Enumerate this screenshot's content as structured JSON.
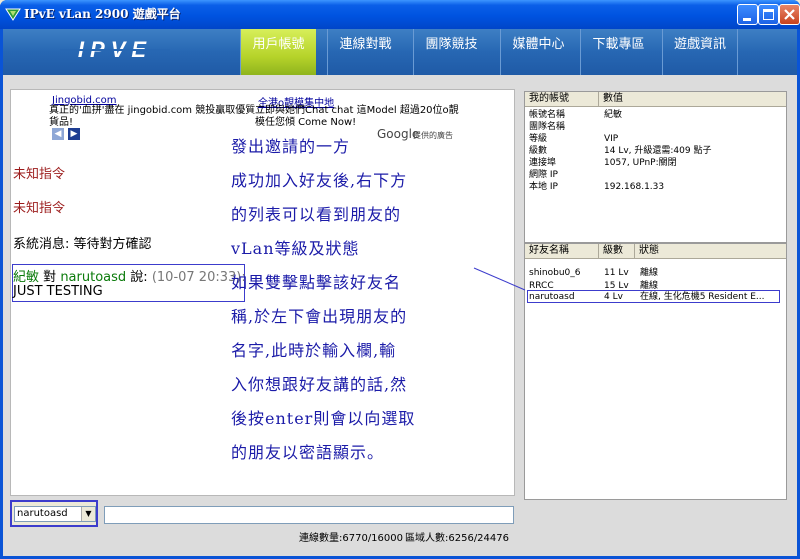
{
  "window": {
    "title": "IPvE vLan 2900 遊戲平台"
  },
  "nav": {
    "logo_text": "IPVE",
    "tabs": [
      {
        "label": "用戶帳號",
        "active": true
      },
      {
        "label": "連線對戰",
        "active": false
      },
      {
        "label": "團隊競技",
        "active": false
      },
      {
        "label": "媒體中心",
        "active": false
      },
      {
        "label": "下載專區",
        "active": false
      },
      {
        "label": "遊戲資訊",
        "active": false
      }
    ]
  },
  "ads": {
    "link1": "Jingobid.com",
    "text1": "真正的'血拼'盡在 jingobid.com 競投贏取優質貨品!",
    "link2": "全港o靚模集中地",
    "text2": "立即與她們Chat chat 這Model 超過20位o靚模任您傾 Come Now!",
    "google": "Google",
    "credit": "提供的廣告"
  },
  "chat": {
    "system1": "未知指令",
    "system2": "未知指令",
    "system3": "系統消息: 等待對方確認",
    "sender": "紀敏",
    "to_word": "對",
    "recipient": "narutoasd",
    "said": "說:",
    "time": "(10-07 20:33):",
    "body": "JUST TESTING"
  },
  "tutorial": {
    "lines": [
      "發出邀請的一方",
      "成功加入好友後,右下方",
      "的列表可以看到朋友的",
      "vLan等級及狀態",
      "如果雙擊點擊該好友名",
      "稱,於左下會出現朋友的",
      "名字,此時於輸入欄,輸",
      "入你想跟好友講的話,然",
      "後按enter則會以向選取",
      "的朋友以密語顯示。"
    ]
  },
  "account": {
    "headers": [
      "我的帳號",
      "數值"
    ],
    "rows": [
      [
        "帳號名稱",
        "紀敏"
      ],
      [
        "團隊名稱",
        ""
      ],
      [
        "等級",
        "VIP"
      ],
      [
        "級數",
        "14 Lv, 升級還需:409 點子"
      ],
      [
        "連接埠",
        "1057, UPnP:關閉"
      ],
      [
        "網際 IP",
        ""
      ],
      [
        "本地 IP",
        "192.168.1.33"
      ]
    ]
  },
  "friends": {
    "headers": [
      "好友名稱",
      "級數",
      "狀態"
    ],
    "rows": [
      [
        "shinobu0_6",
        "11 Lv",
        "離線"
      ],
      [
        "RRCC",
        "15 Lv",
        "離線"
      ],
      [
        "narutoasd",
        "4 Lv",
        "在線, 生化危機5 Resident E..."
      ]
    ]
  },
  "input": {
    "recipient": "narutoasd",
    "message": ""
  },
  "status": {
    "online": "連線數量:6770/16000",
    "region": "區域人數:6256/24476"
  },
  "colors": {
    "accent": "#0a54d6",
    "annotation": "#3c3ccc",
    "tutorial_text": "#1b1ba8"
  }
}
